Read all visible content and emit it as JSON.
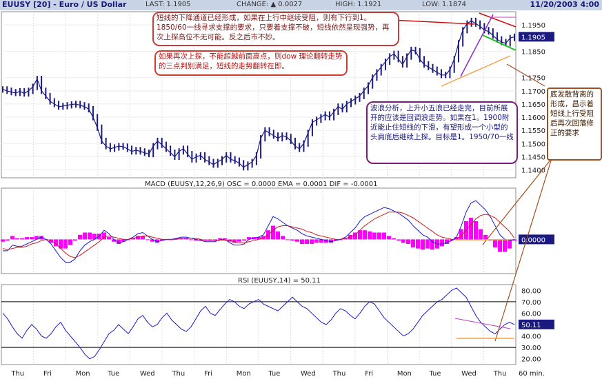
{
  "header": {
    "symbol": "EUUSY [20] - Euro / US Dollar",
    "last": "LAST: 1.1905",
    "change": "CHANGE: ▲ 0.0027",
    "high": "HIGH: 1.1921",
    "low": "LOW: 1.1874",
    "datetime": "11/20/2003 4:00"
  },
  "annotations": {
    "a1": "短线的下降通道已经形成，如果在上行中继续受阻，则有下行到1。1850/60一线寻求支撑的要求，只要着支撑不破，短线依然呈现强势，再次上探高位不无可能。反之后市不妙。",
    "a2": "如果再次上探，不能超越前面高点，则dow 理论翻转走势的三点判别满足，短线的走势翻转在即。",
    "a3": "波浪分析，上升小五浪已经走完，目前所展开的应该是回调浪走势。如果在1。1900附近能止住短线的下滑，有望形成一个小型的头肩底后继续上探。目标是1。1950/70一线",
    "a4": "底发散背离的形成，昌示着短线上行受阻后再次回落修正的要求"
  },
  "chart_data": [
    {
      "type": "line",
      "panel": "price",
      "xlabel": "",
      "ylabel": "",
      "ylim": [
        1.137,
        1.2
      ],
      "yticks": [
        "1.1950",
        "1.1850",
        "1.1750",
        "1.1700",
        "1.1650",
        "1.1600",
        "1.1550",
        "1.1500",
        "1.1450",
        "1.1400"
      ],
      "last_value": "1.1905",
      "x_labels": [
        "Thu",
        "Fri",
        "Mon",
        "Tue",
        "Wed",
        "Thu",
        "Fri",
        "Mon",
        "Tue",
        "Wed",
        "Thu",
        "Fri",
        "Mon",
        "Tue",
        "Wed",
        "Thu",
        "60 min."
      ],
      "close": [
        1.1705,
        1.17,
        1.1695,
        1.1692,
        1.1698,
        1.169,
        1.17,
        1.1715,
        1.1745,
        1.17,
        1.168,
        1.166,
        1.165,
        1.164,
        1.1642,
        1.1645,
        1.1648,
        1.165,
        1.1645,
        1.164,
        1.163,
        1.16,
        1.156,
        1.151,
        1.149,
        1.148,
        1.1485,
        1.149,
        1.1488,
        1.148,
        1.147,
        1.1475,
        1.147,
        1.1465,
        1.146,
        1.149,
        1.151,
        1.1495,
        1.148,
        1.1465,
        1.145,
        1.147,
        1.148,
        1.146,
        1.144,
        1.145,
        1.1455,
        1.144,
        1.143,
        1.142,
        1.143,
        1.144,
        1.1455,
        1.144,
        1.1435,
        1.1425,
        1.141,
        1.142,
        1.143,
        1.1455,
        1.152,
        1.155,
        1.154,
        1.153,
        1.152,
        1.153,
        1.1525,
        1.151,
        1.149,
        1.148,
        1.15,
        1.154,
        1.158,
        1.159,
        1.16,
        1.161,
        1.16,
        1.162,
        1.164,
        1.163,
        1.165,
        1.166,
        1.167,
        1.168,
        1.17,
        1.172,
        1.175,
        1.177,
        1.179,
        1.181,
        1.183,
        1.184,
        1.182,
        1.18,
        1.183,
        1.1855,
        1.185,
        1.182,
        1.18,
        1.179,
        1.178,
        1.177,
        1.176,
        1.176,
        1.178,
        1.182,
        1.188,
        1.193,
        1.1955,
        1.1965,
        1.1955,
        1.1945,
        1.193,
        1.1925,
        1.191,
        1.1895,
        1.1885,
        1.188,
        1.19,
        1.1905
      ]
    },
    {
      "type": "line",
      "panel": "macd",
      "title": "MACD (EUUSY,12,26,9)  OSC = 0.0000  EMA = 0.0001  DIF = -0.0001",
      "legend": [
        "OSC = 0.0000",
        "EMA = 0.0001",
        "DIF = -0.0001"
      ],
      "last_value": "0.0000",
      "ylim": [
        -0.003,
        0.0045
      ],
      "series": [
        {
          "name": "DIF",
          "values": [
            -0.001,
            -0.001,
            -0.0005,
            -0.0006,
            -0.0006,
            -0.0004,
            -0.0002,
            0.0,
            0.0002,
            0.0,
            -0.0004,
            -0.001,
            -0.0016,
            -0.002,
            -0.002,
            -0.0017,
            -0.001,
            -0.0005,
            -0.0002,
            0.0,
            0.0003,
            0.0008,
            0.0005,
            0.0,
            -0.0003,
            -0.0002,
            0.0,
            0.0002,
            0.0005,
            0.0006,
            0.0003,
            0.0,
            -0.0002,
            -0.0001,
            0.0,
            0.0,
            0.0001,
            0.0002,
            0.0002,
            0.0001,
            0.0,
            -0.0001,
            -0.0002,
            -0.0002,
            -0.0002,
            0.0,
            0.0,
            -0.0003,
            -0.0005,
            -0.0005,
            -0.0004,
            0.0,
            0.0001,
            0.0002,
            0.0004,
            0.0012,
            0.002,
            0.0018,
            0.0015,
            0.0012,
            0.001,
            0.0008,
            0.0005,
            0.0003,
            0.0002,
            0.0001,
            0.0,
            -0.0001,
            -0.0002,
            -0.0001,
            0.0,
            0.0002,
            0.0006,
            0.001,
            0.0016,
            0.002,
            0.0022,
            0.0024,
            0.0026,
            0.0028,
            0.0027,
            0.0025,
            0.0023,
            0.002,
            0.0017,
            0.0012,
            0.0008,
            0.0004,
            0.0002,
            -0.0002,
            -0.0004,
            -0.0004,
            -0.0003,
            -0.0001,
            0.0002,
            0.0012,
            0.0024,
            0.0032,
            0.0034,
            0.003,
            0.0026,
            0.002,
            0.0012,
            0.0004,
            0.0,
            -0.0001,
            0.0
          ]
        },
        {
          "name": "EMA",
          "values": [
            -0.0008,
            -0.0009,
            -0.0008,
            -0.0007,
            -0.0007,
            -0.0006,
            -0.0004,
            -0.0003,
            -0.0001,
            0.0,
            -0.0001,
            -0.0004,
            -0.0008,
            -0.0012,
            -0.0015,
            -0.0016,
            -0.0014,
            -0.0011,
            -0.0008,
            -0.0005,
            -0.0002,
            0.0002,
            0.0003,
            0.0002,
            0.0001,
            0.0,
            0.0,
            0.0001,
            0.0002,
            0.0003,
            0.0003,
            0.0002,
            0.0001,
            0.0,
            0.0,
            0.0,
            0.0,
            0.0001,
            0.0001,
            0.0001,
            0.0001,
            0.0,
            -0.0001,
            -0.0001,
            -0.0001,
            -0.0001,
            -0.0001,
            -0.0001,
            -0.0002,
            -0.0003,
            -0.0003,
            -0.0002,
            -0.0001,
            0.0,
            0.0001,
            0.0004,
            0.0008,
            0.0011,
            0.0012,
            0.0012,
            0.0011,
            0.001,
            0.0009,
            0.0007,
            0.0006,
            0.0004,
            0.0003,
            0.0002,
            0.0001,
            0.0,
            0.0,
            0.0001,
            0.0002,
            0.0004,
            0.0008,
            0.0012,
            0.0015,
            0.0018,
            0.002,
            0.0022,
            0.0024,
            0.0024,
            0.0024,
            0.0023,
            0.0021,
            0.0019,
            0.0016,
            0.0013,
            0.001,
            0.0007,
            0.0004,
            0.0002,
            0.0001,
            0.0,
            0.0,
            0.0003,
            0.0008,
            0.0013,
            0.0018,
            0.0021,
            0.0022,
            0.0021,
            0.0019,
            0.0015,
            0.0011,
            0.0007,
            0.0001
          ]
        },
        {
          "name": "OSC",
          "values": [
            -0.0002,
            -0.0001,
            0.0003,
            0.0001,
            0.0001,
            0.0002,
            0.0002,
            0.0003,
            0.0003,
            0.0,
            -0.0003,
            -0.0006,
            -0.0008,
            -0.0008,
            -0.0005,
            -0.0001,
            0.0004,
            0.0006,
            0.0006,
            0.0005,
            0.0005,
            0.0006,
            0.0002,
            -0.0002,
            -0.0004,
            -0.0002,
            0.0,
            0.0001,
            0.0003,
            0.0003,
            0.0,
            -0.0002,
            -0.0003,
            -0.0001,
            0.0,
            0.0,
            0.0001,
            0.0001,
            0.0001,
            0.0,
            -0.0001,
            -0.0001,
            -0.0001,
            -0.0001,
            -0.0001,
            0.0001,
            0.0001,
            -0.0002,
            -0.0003,
            -0.0002,
            -0.0001,
            0.0002,
            0.0002,
            0.0002,
            0.0003,
            0.0008,
            0.0012,
            0.0007,
            0.0003,
            0.0,
            -0.0001,
            -0.0002,
            -0.0004,
            -0.0004,
            -0.0004,
            -0.0003,
            -0.0003,
            -0.0003,
            -0.0003,
            -0.0001,
            0.0,
            0.0001,
            0.0004,
            0.0006,
            0.0008,
            0.0008,
            0.0007,
            0.0006,
            0.0006,
            0.0006,
            0.0003,
            0.0001,
            -0.0001,
            -0.0003,
            -0.0004,
            -0.0007,
            -0.0008,
            -0.0009,
            -0.0008,
            -0.0009,
            -0.0008,
            -0.0006,
            -0.0004,
            -0.0001,
            0.0002,
            0.0009,
            0.0016,
            0.0019,
            0.0016,
            0.0009,
            0.0004,
            -0.0001,
            -0.0007,
            -0.0011,
            -0.0011,
            -0.0008,
            -0.0001
          ]
        }
      ]
    },
    {
      "type": "line",
      "panel": "rsi",
      "title": "RSI (EUUSY,14) = 50.11",
      "last_value": "50.11",
      "ylim": [
        15,
        85
      ],
      "yticks": [
        "80.00",
        "70.00",
        "60.00",
        "50.00",
        "40.00",
        "30.00",
        "20.00"
      ],
      "reference_lines": [
        70,
        30
      ],
      "values": [
        60,
        55,
        48,
        42,
        38,
        45,
        50,
        46,
        40,
        38,
        42,
        48,
        52,
        45,
        40,
        35,
        30,
        24,
        20,
        22,
        28,
        35,
        42,
        45,
        50,
        46,
        42,
        48,
        55,
        58,
        52,
        48,
        50,
        56,
        60,
        54,
        50,
        46,
        44,
        48,
        55,
        62,
        66,
        60,
        58,
        63,
        68,
        72,
        70,
        66,
        64,
        68,
        70,
        72,
        68,
        66,
        64,
        62,
        66,
        70,
        74,
        70,
        66,
        64,
        60,
        56,
        52,
        50,
        54,
        60,
        64,
        62,
        58,
        55,
        60,
        66,
        70,
        68,
        62,
        56,
        52,
        48,
        44,
        40,
        42,
        46,
        52,
        58,
        62,
        66,
        70,
        72,
        76,
        80,
        82,
        78,
        74,
        66,
        58,
        52,
        48,
        44,
        42,
        46,
        50,
        52,
        50
      ]
    }
  ]
}
